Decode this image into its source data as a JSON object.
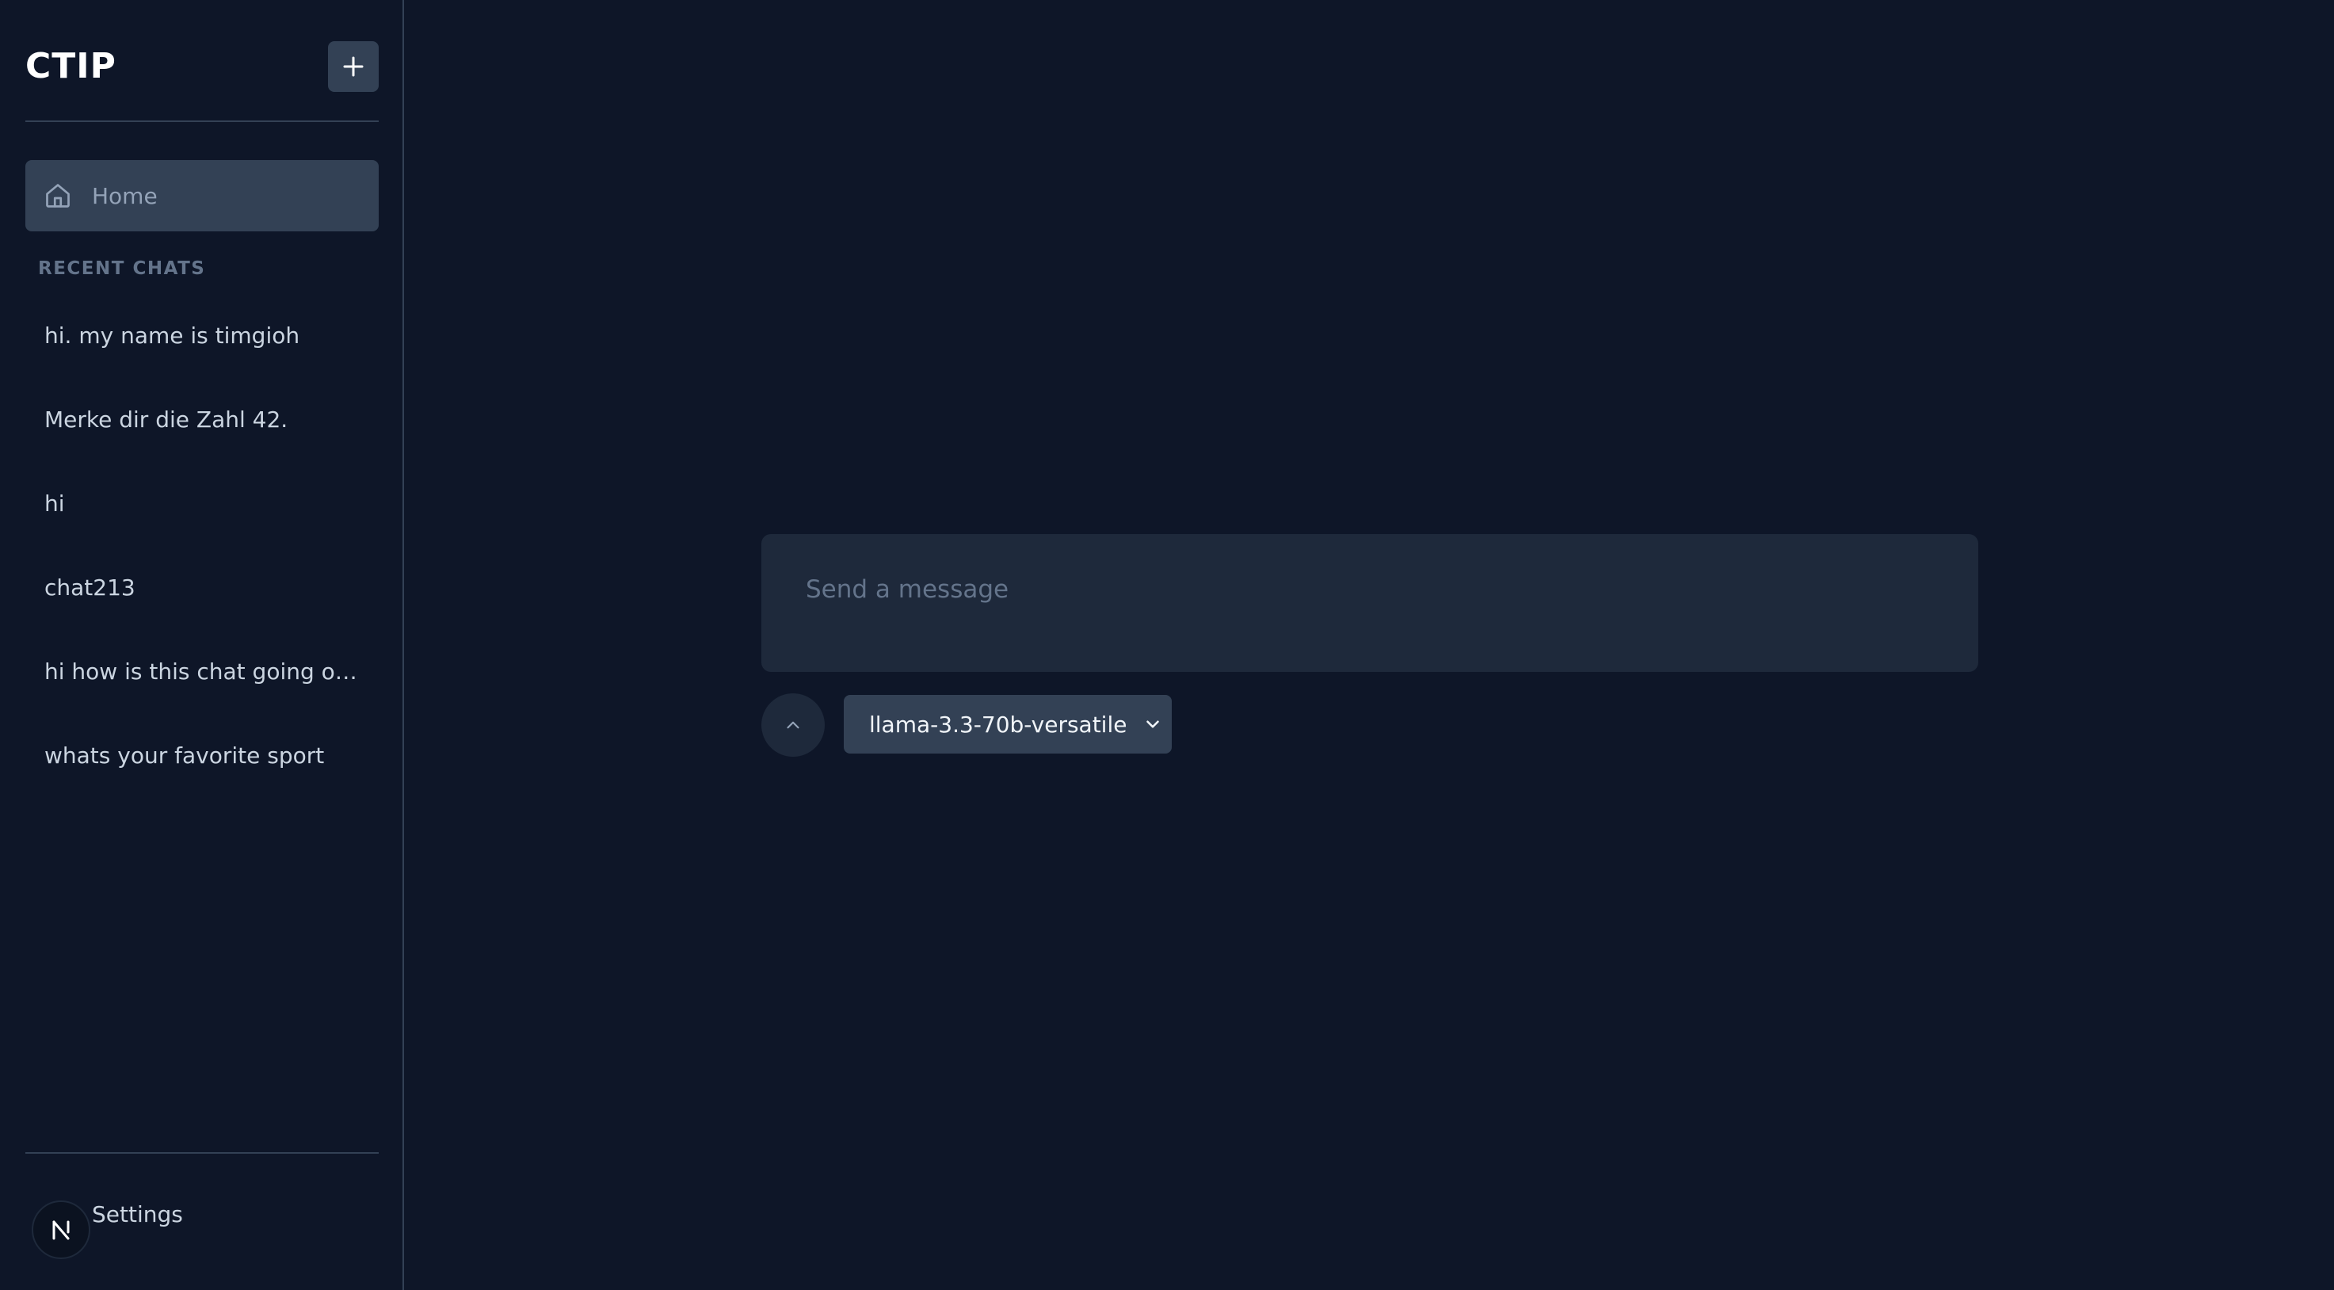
{
  "sidebar": {
    "brand": "CTIP",
    "new_chat_icon": "plus-icon",
    "home": {
      "icon": "home-icon",
      "label": "Home"
    },
    "recent_title": "RECENT CHATS",
    "recent_chats": [
      "hi. my name is timgioh",
      "Merke dir die Zahl 42.",
      "hi",
      "chat213",
      "hi how is this chat going oyu...",
      "whats your favorite sport"
    ],
    "settings": {
      "avatar_letter": "N",
      "label": "Settings"
    }
  },
  "composer": {
    "placeholder": "Send a message",
    "value": "",
    "expand_icon": "chevron-up-icon",
    "model": {
      "selected": "llama-3.3-70b-versatile",
      "icon": "chevron-down-icon"
    }
  },
  "colors": {
    "background": "#0e1628",
    "panel": "#1e293b",
    "active": "#334155",
    "text": "#cbd5e1",
    "muted": "#64748b"
  }
}
